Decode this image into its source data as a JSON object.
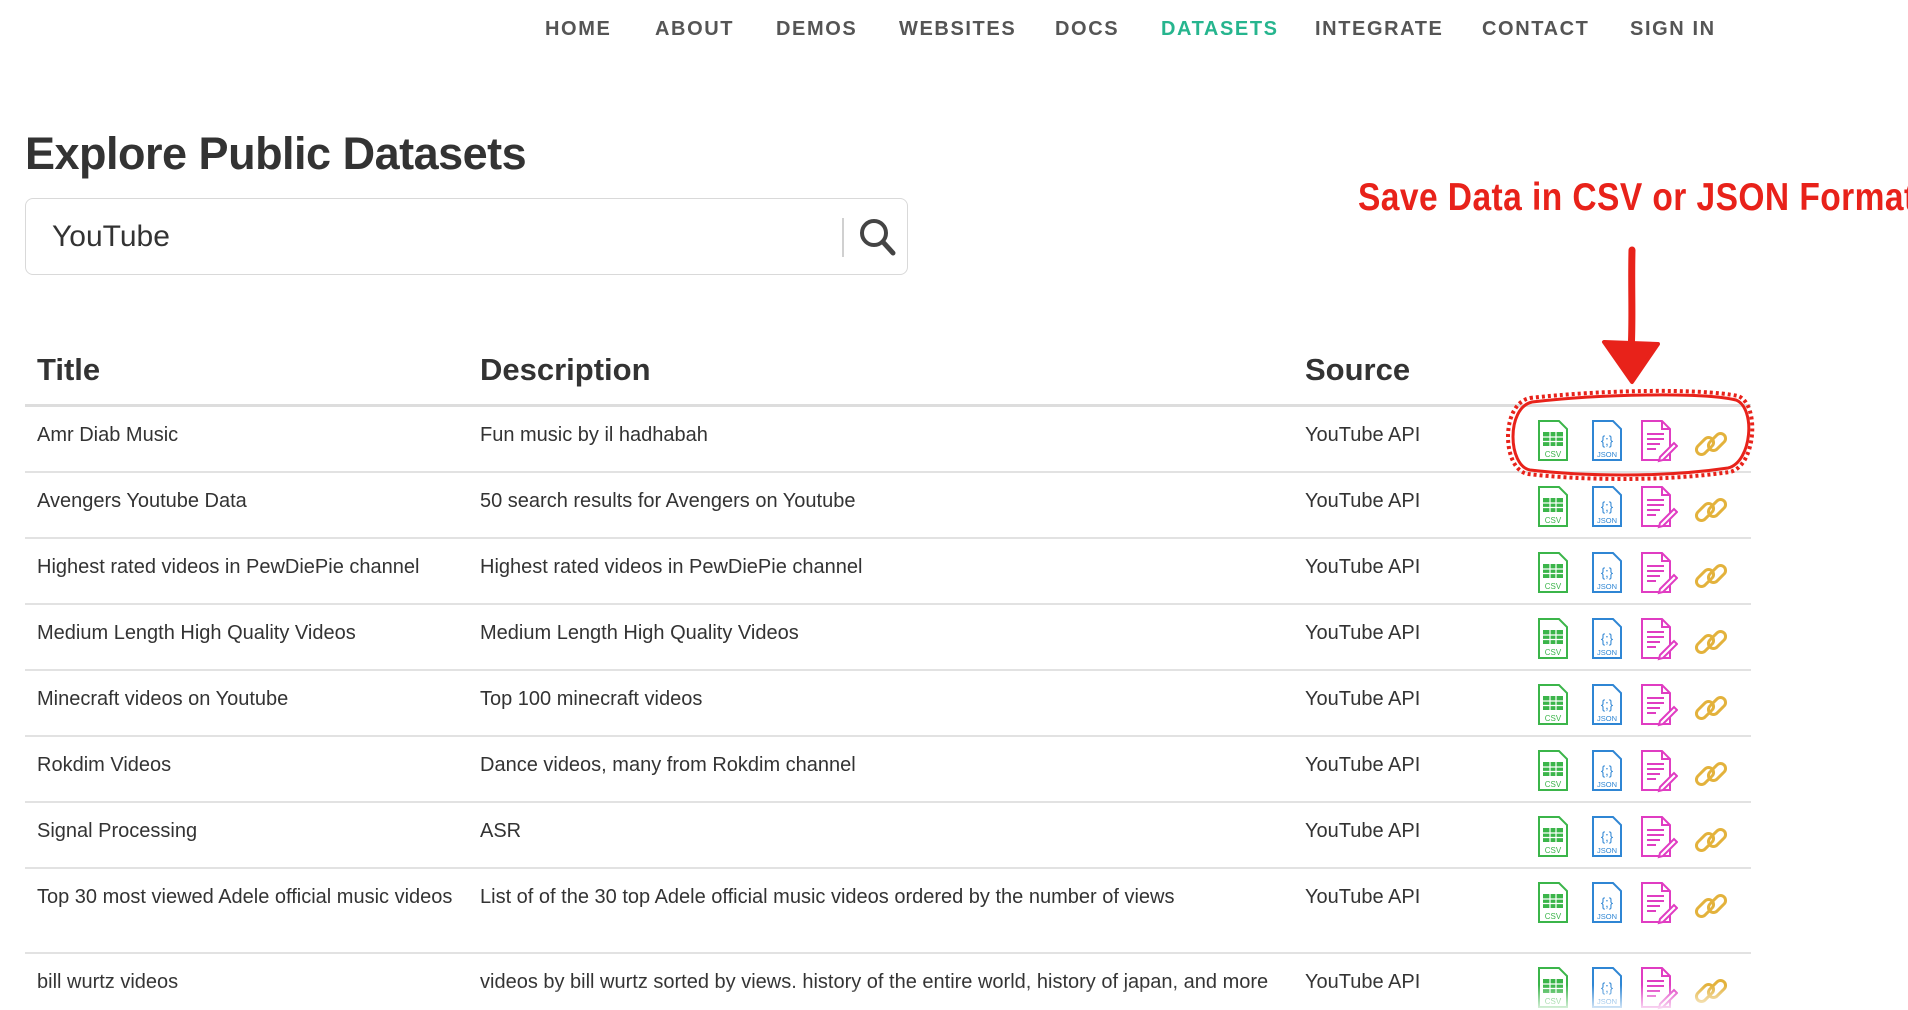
{
  "nav": {
    "items": [
      {
        "label": "HOME",
        "active": false
      },
      {
        "label": "ABOUT",
        "active": false
      },
      {
        "label": "DEMOS",
        "active": false
      },
      {
        "label": "WEBSITES",
        "active": false
      },
      {
        "label": "DOCS",
        "active": false
      },
      {
        "label": "DATASETS",
        "active": true
      },
      {
        "label": "INTEGRATE",
        "active": false
      },
      {
        "label": "CONTACT",
        "active": false
      },
      {
        "label": "SIGN IN",
        "active": false
      }
    ]
  },
  "page": {
    "title": "Explore Public Datasets"
  },
  "search": {
    "value": "YouTube",
    "icon": "search-icon"
  },
  "annotation": {
    "text": "Save Data in CSV or JSON Format",
    "color": "#e8221a"
  },
  "table": {
    "headers": {
      "title": "Title",
      "description": "Description",
      "source": "Source"
    },
    "rows": [
      {
        "title": "Amr Diab Music",
        "description": "Fun music by il hadhabah",
        "source": "YouTube API"
      },
      {
        "title": "Avengers Youtube Data",
        "description": "50 search results for Avengers on Youtube",
        "source": "YouTube API"
      },
      {
        "title": "Highest rated videos in PewDiePie channel",
        "description": "Highest rated videos in PewDiePie channel",
        "source": "YouTube API"
      },
      {
        "title": "Medium Length High Quality Videos",
        "description": "Medium Length High Quality Videos",
        "source": "YouTube API"
      },
      {
        "title": "Minecraft videos on Youtube",
        "description": "Top 100 minecraft videos",
        "source": "YouTube API"
      },
      {
        "title": "Rokdim Videos",
        "description": "Dance videos, many from Rokdim channel",
        "source": "YouTube API"
      },
      {
        "title": "Signal Processing",
        "description": "ASR",
        "source": "YouTube API"
      },
      {
        "title": "Top 30 most viewed Adele official music videos",
        "description": "List of of the 30 top Adele official music videos ordered by the number of views",
        "source": "YouTube API"
      },
      {
        "title": "bill wurtz videos",
        "description": "videos by bill wurtz sorted by views. history of the entire world, history of japan, and more",
        "source": "YouTube API"
      }
    ],
    "actions": {
      "csv_label": "CSV",
      "json_label": "JSON",
      "csv_color": "#3bb54a",
      "json_color": "#2f86d4",
      "edit_color": "#e03cc2",
      "link_color": "#e3b23c"
    }
  },
  "colors": {
    "accent": "#26b58e",
    "text": "#333333",
    "nav_text": "#555555"
  }
}
